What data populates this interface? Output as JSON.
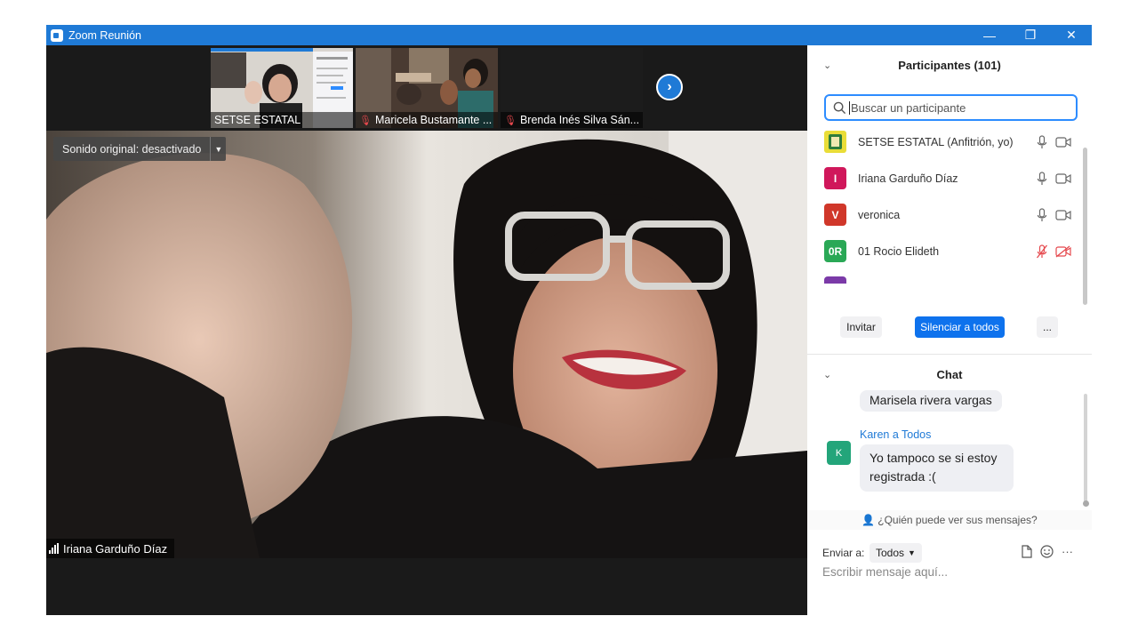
{
  "window": {
    "title": "Zoom Reunión",
    "controls": [
      "—",
      "❐",
      "✕"
    ]
  },
  "thumbnails": [
    {
      "name": "SETSE ESTATAL",
      "muted": false
    },
    {
      "name": "Maricela Bustamante ...",
      "muted": true
    },
    {
      "name": "Brenda Inés Silva Sán...",
      "muted": true
    }
  ],
  "main_video": {
    "sound_label": "Sonido original: desactivado",
    "speaker_name": "Iriana Garduño Díaz"
  },
  "participants_panel": {
    "title": "Participantes (101)",
    "search_placeholder": "Buscar un participante",
    "participants": [
      {
        "initials": "",
        "name": "SETSE ESTATAL (Anfitrión, yo)",
        "avatar_color": "#e9dd38",
        "muted": false
      },
      {
        "initials": "I",
        "name": "Iriana Garduño Díaz",
        "avatar_color": "#d0175b",
        "muted": false
      },
      {
        "initials": "V",
        "name": "veronica",
        "avatar_color": "#d0372a",
        "muted": false
      },
      {
        "initials": "0R",
        "name": "01 Rocio Elideth",
        "avatar_color": "#2aa856",
        "muted": true
      }
    ],
    "invite_label": "Invitar",
    "mute_all_label": "Silenciar a todos",
    "more_label": "..."
  },
  "chat_panel": {
    "title": "Chat",
    "messages": [
      {
        "text": "Marisela rivera vargas"
      },
      {
        "from": "Karen a Todos",
        "avatar": "K",
        "text_line1": "Yo tampoco se si estoy",
        "text_line2": "registrada :("
      }
    ],
    "who_sees": "¿Quién puede ver sus mensajes?",
    "send_to_label": "Enviar a:",
    "send_to_value": "Todos",
    "input_placeholder": "Escribir mensaje aquí..."
  },
  "colors": {
    "titlebar": "#1f7ad6",
    "accent": "#0e72ed",
    "muted_red": "#e5484d"
  }
}
